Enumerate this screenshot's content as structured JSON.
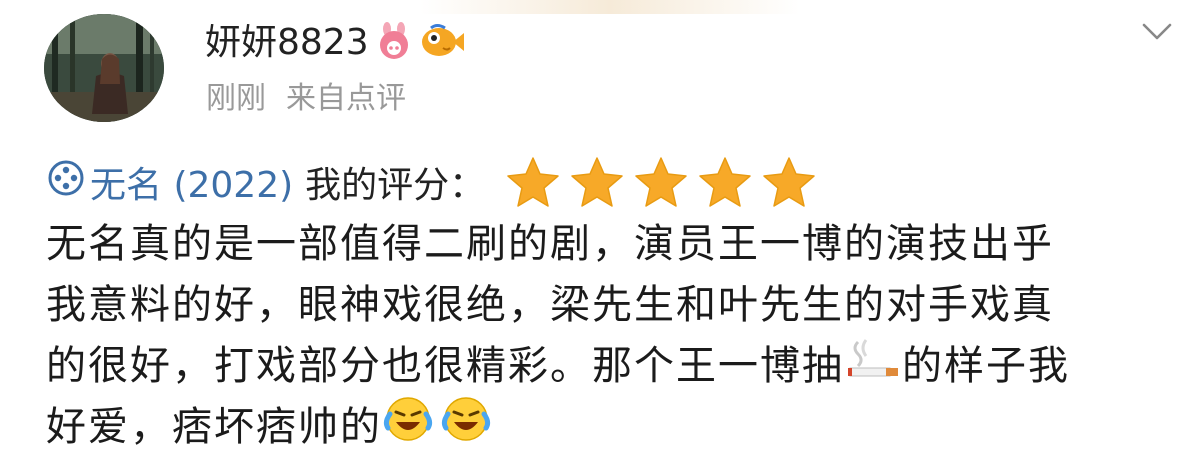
{
  "post": {
    "username": "妍妍8823",
    "time": "刚刚",
    "source": "来自点评",
    "movie_link": "无名 (2022)",
    "rating_label": "我的评分：",
    "rating_stars": 5,
    "rating_max": 5,
    "text": {
      "line1": "无名真的是一部值得二刷的剧，演员王一博的演技出乎",
      "line2": "我意料的好，眼神戏很绝，梁先生和叶先生的对手戏真",
      "line3a": "的很好，打戏部分也很精彩。那个王一博抽",
      "line3b": "的样子我",
      "line4": "好爱，痞坏痞帅的"
    }
  },
  "icons": [
    "movie-reel-icon",
    "star-icon",
    "cigarette-emoji-icon",
    "laugh-cry-emoji-icon",
    "pink-badge-icon",
    "fish-badge-icon",
    "chevron-down-icon"
  ],
  "colors": {
    "link": "#3d6fa8",
    "star": "#f7a928",
    "meta": "#999999",
    "text": "#1b1b1b"
  }
}
